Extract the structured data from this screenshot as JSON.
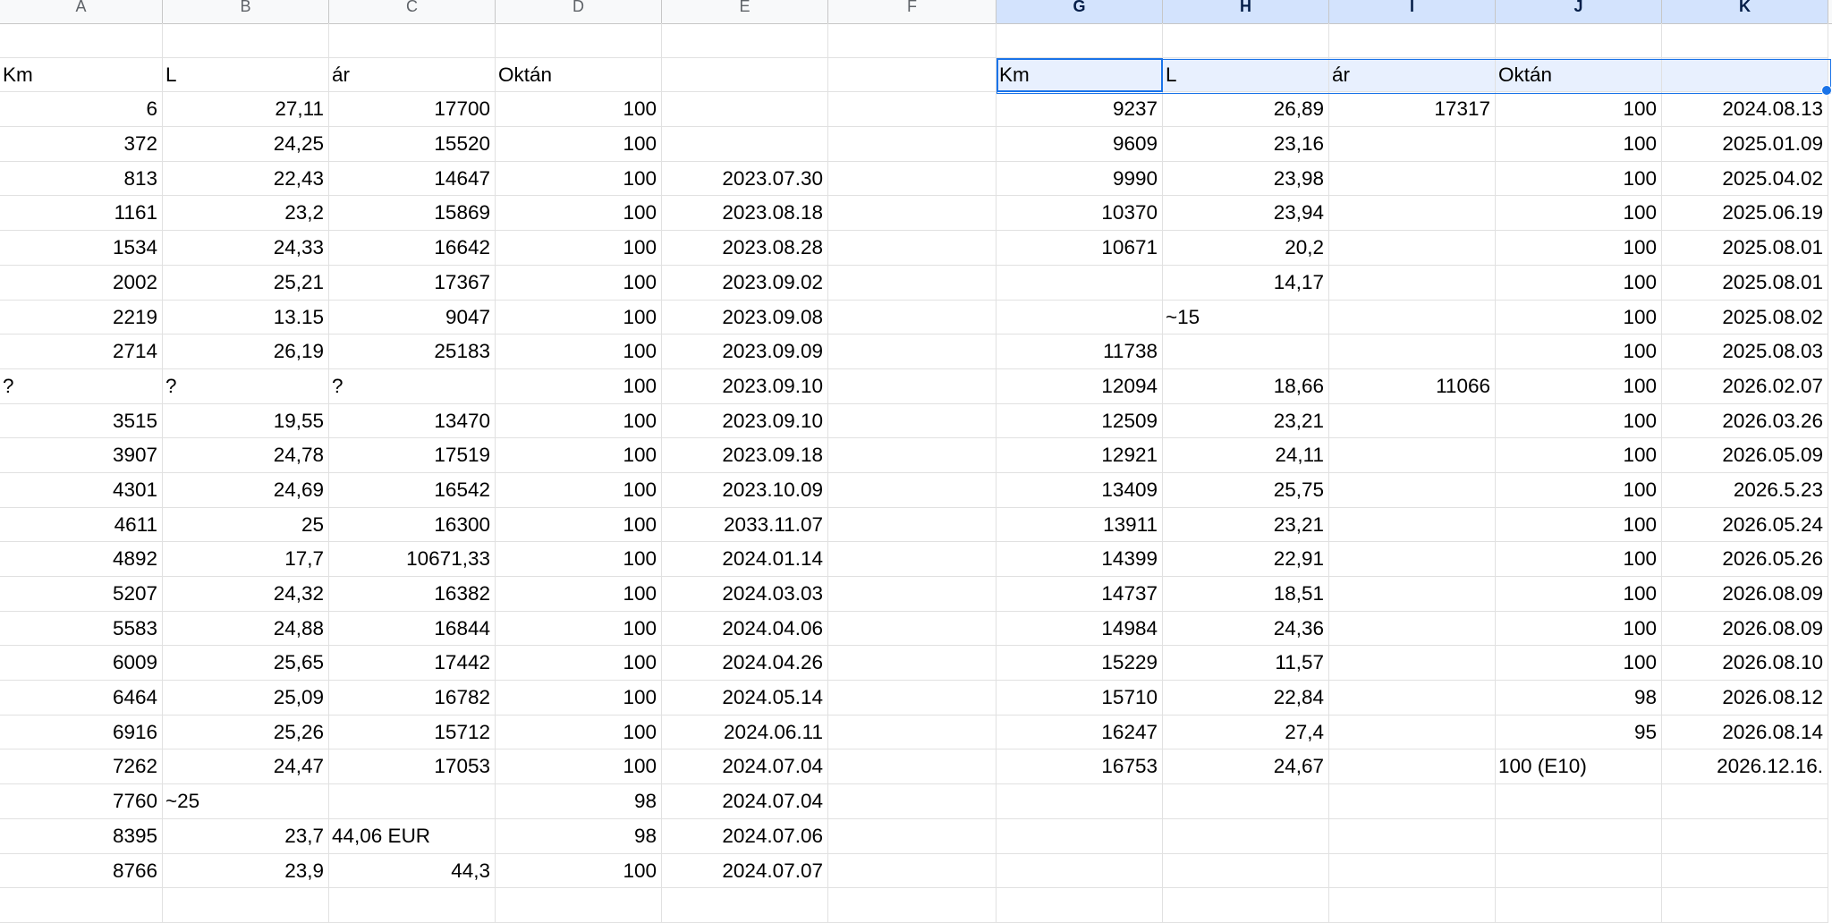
{
  "columns": [
    "A",
    "B",
    "C",
    "D",
    "E",
    "F",
    "G",
    "H",
    "I",
    "J",
    "K"
  ],
  "selected_columns": [
    "G",
    "H",
    "I",
    "J",
    "K"
  ],
  "rows": [
    [
      "",
      "",
      "",
      "",
      "",
      "",
      "",
      "",
      "",
      "",
      ""
    ],
    [
      "Km",
      "L",
      "ár",
      "Oktán",
      "",
      "",
      "Km",
      "L",
      "ár",
      "Oktán",
      ""
    ],
    [
      "6",
      "27,11",
      "17700",
      "100",
      "",
      "",
      "9237",
      "26,89",
      "17317",
      "100",
      "2024.08.13"
    ],
    [
      "372",
      "24,25",
      "15520",
      "100",
      "",
      "",
      "9609",
      "23,16",
      "",
      "100",
      "2025.01.09"
    ],
    [
      "813",
      "22,43",
      "14647",
      "100",
      "2023.07.30",
      "",
      "9990",
      "23,98",
      "",
      "100",
      "2025.04.02"
    ],
    [
      "1161",
      "23,2",
      "15869",
      "100",
      "2023.08.18",
      "",
      "10370",
      "23,94",
      "",
      "100",
      "2025.06.19"
    ],
    [
      "1534",
      "24,33",
      "16642",
      "100",
      "2023.08.28",
      "",
      "10671",
      "20,2",
      "",
      "100",
      "2025.08.01"
    ],
    [
      "2002",
      "25,21",
      "17367",
      "100",
      "2023.09.02",
      "",
      "",
      "14,17",
      "",
      "100",
      "2025.08.01"
    ],
    [
      "2219",
      "13.15",
      "9047",
      "100",
      "2023.09.08",
      "",
      "",
      "~15",
      "",
      "100",
      "2025.08.02"
    ],
    [
      "2714",
      "26,19",
      "25183",
      "100",
      "2023.09.09",
      "",
      "11738",
      "",
      "",
      "100",
      "2025.08.03"
    ],
    [
      "?",
      "?",
      "?",
      "100",
      "2023.09.10",
      "",
      "12094",
      "18,66",
      "11066",
      "100",
      "2026.02.07"
    ],
    [
      "3515",
      "19,55",
      "13470",
      "100",
      "2023.09.10",
      "",
      "12509",
      "23,21",
      "",
      "100",
      "2026.03.26"
    ],
    [
      "3907",
      "24,78",
      "17519",
      "100",
      "2023.09.18",
      "",
      "12921",
      "24,11",
      "",
      "100",
      "2026.05.09"
    ],
    [
      "4301",
      "24,69",
      "16542",
      "100",
      "2023.10.09",
      "",
      "13409",
      "25,75",
      "",
      "100",
      "2026.5.23"
    ],
    [
      "4611",
      "25",
      "16300",
      "100",
      "2033.11.07",
      "",
      "13911",
      "23,21",
      "",
      "100",
      "2026.05.24"
    ],
    [
      "4892",
      "17,7",
      "10671,33",
      "100",
      "2024.01.14",
      "",
      "14399",
      "22,91",
      "",
      "100",
      "2026.05.26"
    ],
    [
      "5207",
      "24,32",
      "16382",
      "100",
      "2024.03.03",
      "",
      "14737",
      "18,51",
      "",
      "100",
      "2026.08.09"
    ],
    [
      "5583",
      "24,88",
      "16844",
      "100",
      "2024.04.06",
      "",
      "14984",
      "24,36",
      "",
      "100",
      "2026.08.09"
    ],
    [
      "6009",
      "25,65",
      "17442",
      "100",
      "2024.04.26",
      "",
      "15229",
      "11,57",
      "",
      "100",
      "2026.08.10"
    ],
    [
      "6464",
      "25,09",
      "16782",
      "100",
      "2024.05.14",
      "",
      "15710",
      "22,84",
      "",
      "98",
      "2026.08.12"
    ],
    [
      "6916",
      "25,26",
      "15712",
      "100",
      "2024.06.11",
      "",
      "16247",
      "27,4",
      "",
      "95",
      "2026.08.14"
    ],
    [
      "7262",
      "24,47",
      "17053",
      "100",
      "2024.07.04",
      "",
      "16753",
      "24,67",
      "",
      "100 (E10)",
      "2026.12.16."
    ],
    [
      "7760",
      "~25",
      "",
      "98",
      "2024.07.04",
      "",
      "",
      "",
      "",
      "",
      ""
    ],
    [
      "8395",
      "23,7",
      "44,06 EUR",
      "98",
      "2024.07.06",
      "",
      "",
      "",
      "",
      "",
      ""
    ],
    [
      "8766",
      "23,9",
      "44,3",
      "100",
      "2024.07.07",
      "",
      "",
      "",
      "",
      "",
      ""
    ],
    [
      "",
      "",
      "",
      "",
      "",
      "",
      "",
      "",
      "",
      "",
      ""
    ]
  ]
}
